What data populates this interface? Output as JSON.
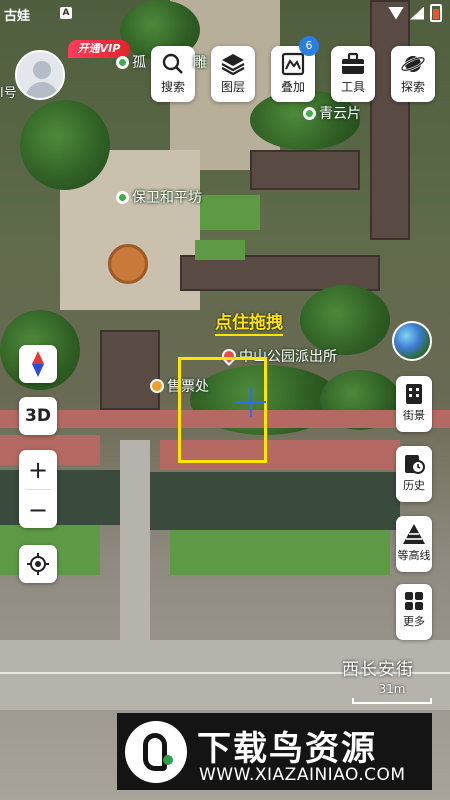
{
  "status_bar": {
    "left_text": "古娃",
    "notif_badge": "A"
  },
  "profile": {
    "vip_label": "开通VIP",
    "edge_text": "l号"
  },
  "toolbar": [
    {
      "label": "搜索",
      "icon": "search-icon"
    },
    {
      "label": "图层",
      "icon": "layers-icon"
    },
    {
      "label": "叠加",
      "icon": "overlay-icon",
      "badge": "6"
    },
    {
      "label": "工具",
      "icon": "toolbox-icon"
    },
    {
      "label": "探索",
      "icon": "planet-icon"
    }
  ],
  "map_labels": {
    "poi_1": "孤",
    "poi_1_right": "雕",
    "poi_2": "青云片",
    "poi_3": "保卫和平坊",
    "poi_4": "中山公园派出所",
    "poi_5": "售票处",
    "drag_hint": "点住拖拽",
    "street": "西长安街"
  },
  "left_controls": {
    "mode_3d": "3D",
    "zoom_in": "+",
    "zoom_out": "−"
  },
  "right_controls": [
    {
      "label": "街景",
      "icon": "street-view-icon"
    },
    {
      "label": "历史",
      "icon": "history-icon"
    },
    {
      "label": "等高线",
      "icon": "contour-icon"
    },
    {
      "label": "更多",
      "icon": "more-grid-icon"
    }
  ],
  "scale": {
    "label": "31m"
  },
  "watermark": {
    "title": "下载鸟资源",
    "url": "WWW.XIAZAINIAO.COM"
  },
  "colors": {
    "highlight_yellow": "#ffe600",
    "vip_red": "#e3242b",
    "badge_blue": "#2a7de1",
    "poi_green": "#3fae4c"
  }
}
